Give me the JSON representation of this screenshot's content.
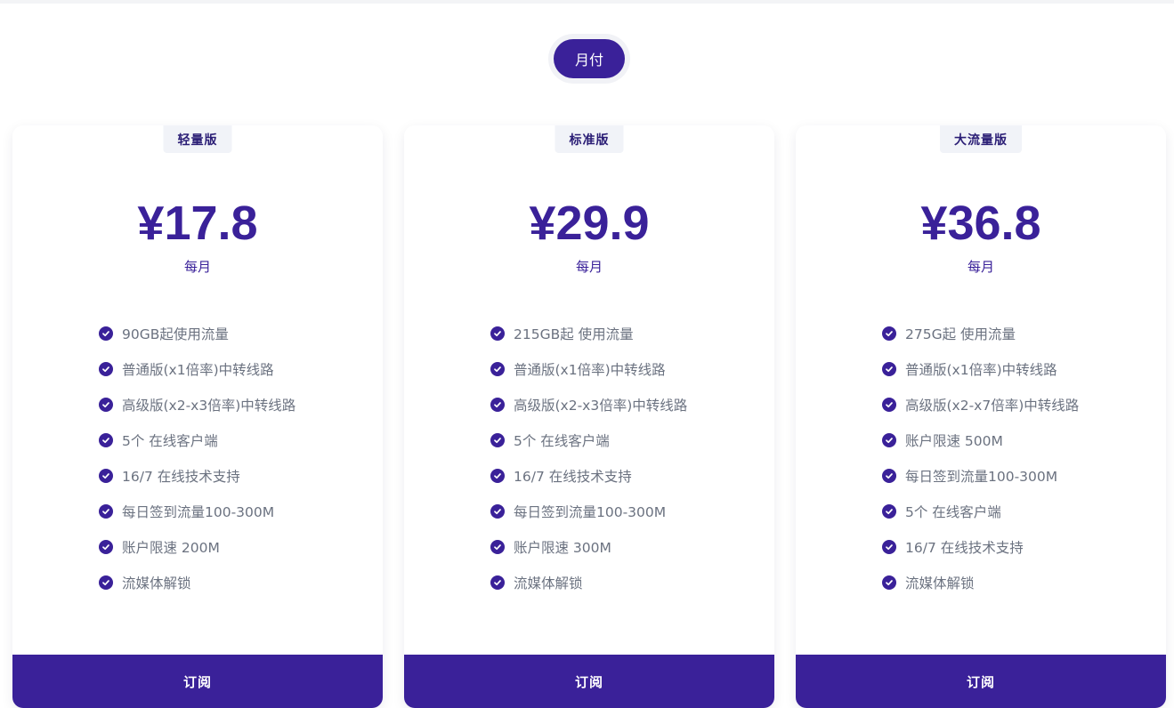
{
  "billing_toggle": {
    "label": "月付"
  },
  "plans": [
    {
      "name": "轻量版",
      "price": "¥17.8",
      "period": "每月",
      "features": [
        "90GB起使用流量",
        "普通版(x1倍率)中转线路",
        "高级版(x2-x3倍率)中转线路",
        "5个 在线客户端",
        "16/7 在线技术支持",
        "每日签到流量100-300M",
        "账户限速 200M",
        "流媒体解锁"
      ],
      "button_label": "订阅"
    },
    {
      "name": "标准版",
      "price": "¥29.9",
      "period": "每月",
      "features": [
        "215GB起 使用流量",
        "普通版(x1倍率)中转线路",
        "高级版(x2-x3倍率)中转线路",
        "5个 在线客户端",
        "16/7 在线技术支持",
        "每日签到流量100-300M",
        "账户限速 300M",
        "流媒体解锁"
      ],
      "button_label": "订阅"
    },
    {
      "name": "大流量版",
      "price": "¥36.8",
      "period": "每月",
      "features": [
        "275G起 使用流量",
        "普通版(x1倍率)中转线路",
        "高级版(x2-x7倍率)中转线路",
        "账户限速 500M",
        "每日签到流量100-300M",
        "5个 在线客户端",
        "16/7 在线技术支持",
        "流媒体解锁"
      ],
      "button_label": "订阅"
    }
  ],
  "colors": {
    "accent": "#3a2199",
    "feature_text": "#6b7280",
    "badge_bg": "#f1f3f8"
  },
  "icons": {
    "feature": "check-circle-icon"
  }
}
